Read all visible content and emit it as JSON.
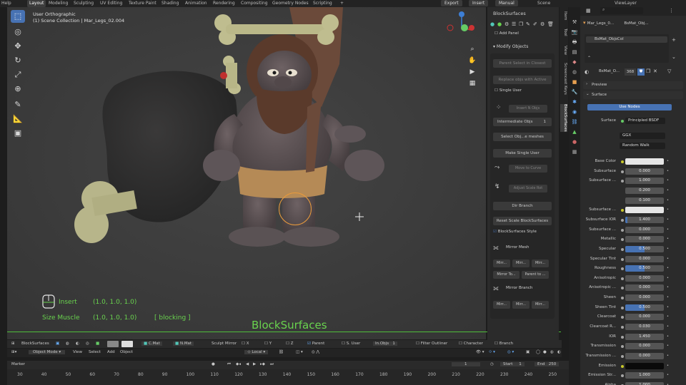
{
  "menu": {
    "app_icon": "blender-logo-icon",
    "help": "Help",
    "workspaces": [
      "Layout",
      "Modeling",
      "Sculpting",
      "UV Editing",
      "Texture Paint",
      "Shading",
      "Animation",
      "Rendering",
      "Compositing",
      "Geometry Nodes",
      "Scripting"
    ],
    "add_tab": "+",
    "export": "Export",
    "insert": "Insert",
    "manual": "Manual",
    "scene": "Scene",
    "view_layer": "ViewLayer"
  },
  "viewport": {
    "title": "User Orthographic",
    "collection": "(1) Scene Collection | Mar_Legs_02.004",
    "hud": {
      "insert_label": "Insert",
      "insert_value": "(1.0, 1.0, 1.0)",
      "size_label": "Size Muscle",
      "size_value": "(1.0, 1.0, 1.0)",
      "mode": "[  blocking  ]"
    },
    "overlay_title": "BlockSurfaces"
  },
  "npanel": {
    "title": "BlockSurfaces",
    "add_panel": "Add Panel",
    "modify_objects": "Modify Objects",
    "parent_select": "Parent Select in Closest",
    "replace_objs": "Replace objs with Active",
    "single_user": "Single User",
    "insert_objs": "Insert N Objs",
    "intermediate_label": "Intermediate Objs",
    "intermediate_value": "1",
    "select_objs": "Select Obj...e meshes",
    "make_single_user": "Make Single User",
    "move_to_curve": "Move to Curve",
    "adjust_scale": "Adjust Scale Rot",
    "dir_branch": "Dir Branch",
    "reset_scale": "Reset Scale BlockSurfaces",
    "blocksurfaces_style": "BlockSurfaces Style",
    "mirror_mesh": "Mirror Mesh",
    "mirror_buttons": [
      "Mirr...",
      "Mirr...",
      "Mirr..."
    ],
    "mirror_to": "Mirror To...",
    "parent_to": "Parent to ...",
    "mirror_branch": "Mirror Branch",
    "branch_buttons": [
      "Mirr...",
      "Mirr...",
      "Mirr..."
    ]
  },
  "sidetabs": [
    "Item",
    "Tool",
    "View",
    "Screencast Keys",
    "BlockSurfaces"
  ],
  "properties": {
    "object_name": "Mar_Legs_0...",
    "material_short": "BsMat_Obj...",
    "material_slot": "BsMat_ObjsCol",
    "material_name": "BsMat_O...",
    "user_count": "368",
    "preview": "Preview",
    "surface": "Surface",
    "use_nodes": "Use Nodes",
    "surface_label": "Surface",
    "surface_shader": "Principled BSDF",
    "distribution": "GGX",
    "subsurface_method": "Random Walk",
    "rows": [
      {
        "label": "Base Color",
        "type": "color",
        "color": "#e6e6e6"
      },
      {
        "label": "Subsurface",
        "type": "num",
        "value": "0.000"
      },
      {
        "label": "Subsurface ...",
        "type": "num",
        "value": "1.000"
      },
      {
        "label": "",
        "type": "num",
        "value": "0.200"
      },
      {
        "label": "",
        "type": "num",
        "value": "0.100"
      },
      {
        "label": "Subsurface ...",
        "type": "color",
        "color": "#e6e6e6"
      },
      {
        "label": "Subsurface IOR",
        "type": "num",
        "value": "1.400",
        "fill": 0.05
      },
      {
        "label": "Subsurface ...",
        "type": "num",
        "value": "0.000"
      },
      {
        "label": "Metallic",
        "type": "num",
        "value": "0.000"
      },
      {
        "label": "Specular",
        "type": "num",
        "value": "0.500",
        "fill": 0.5
      },
      {
        "label": "Specular Tint",
        "type": "num",
        "value": "0.000"
      },
      {
        "label": "Roughness",
        "type": "num",
        "value": "0.500",
        "fill": 0.5
      },
      {
        "label": "Anisotropic",
        "type": "num",
        "value": "0.000"
      },
      {
        "label": "Anisotropic ...",
        "type": "num",
        "value": "0.000"
      },
      {
        "label": "Sheen",
        "type": "num",
        "value": "0.000"
      },
      {
        "label": "Sheen Tint",
        "type": "num",
        "value": "0.500",
        "fill": 0.5
      },
      {
        "label": "Clearcoat",
        "type": "num",
        "value": "0.000"
      },
      {
        "label": "Clearcoat R...",
        "type": "num",
        "value": "0.030"
      },
      {
        "label": "IOR",
        "type": "num",
        "value": "1.450"
      },
      {
        "label": "Transmission",
        "type": "num",
        "value": "0.000"
      },
      {
        "label": "Transmission ...",
        "type": "num",
        "value": "0.000"
      },
      {
        "label": "Emission",
        "type": "color",
        "color": "#0a0a0a"
      },
      {
        "label": "Emission Str...",
        "type": "num",
        "value": "1.000"
      },
      {
        "label": "Alpha",
        "type": "num",
        "value": "1.000"
      }
    ]
  },
  "bs_bar": {
    "title": "BlockSurfaces",
    "c_mat": "C.Mat",
    "n_mat": "N.Mat",
    "sculpt_mirror": "Sculpt Mirror",
    "x": "X",
    "y": "Y",
    "z": "Z",
    "parent": "Parent",
    "s_user": "S. User",
    "in_objs": "In.Objs",
    "in_objs_value": "1",
    "filter_outliner": "Filter Outliner",
    "character": "Character",
    "branch": "Branch"
  },
  "mode_bar": {
    "mode": "Object Mode",
    "view": "View",
    "select": "Select",
    "add": "Add",
    "object": "Object",
    "orientation": "Local"
  },
  "timeline": {
    "marker": "Marker",
    "current_frame": "1",
    "start_label": "Start",
    "start": "1",
    "end_label": "End",
    "end": "250",
    "ticks": [
      "30",
      "40",
      "50",
      "60",
      "70",
      "80",
      "90",
      "100",
      "110",
      "120",
      "130",
      "140",
      "150",
      "160",
      "170",
      "180",
      "190",
      "200",
      "210",
      "220",
      "230",
      "240",
      "250"
    ]
  }
}
